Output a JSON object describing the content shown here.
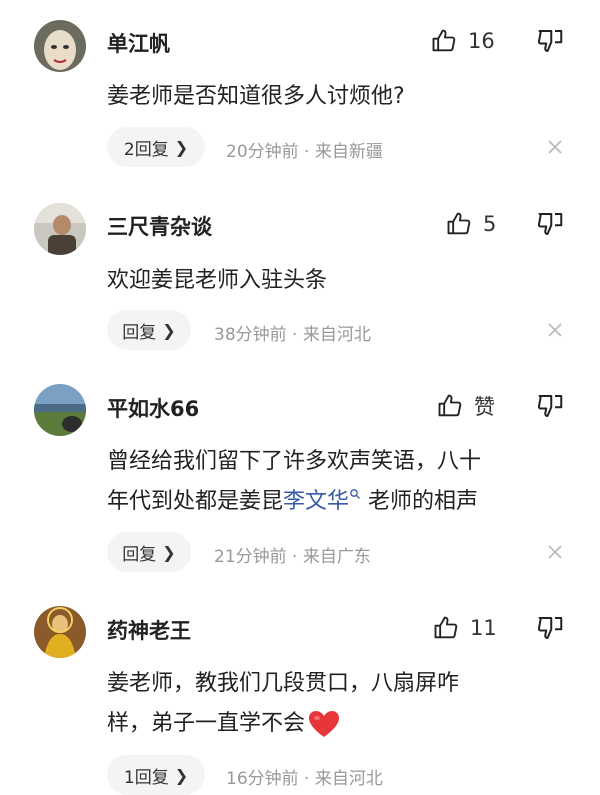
{
  "comments": [
    {
      "username": "单江帆",
      "like_count": "16",
      "body": "姜老师是否知道很多人讨烦他?",
      "reply_label": "2回复",
      "meta": "20分钟前 · 来自新疆"
    },
    {
      "username": "三尺青杂谈",
      "like_count": "5",
      "body": "欢迎姜昆老师入驻头条",
      "reply_label": "回复",
      "meta": "38分钟前 · 来自河北"
    },
    {
      "username": "平如水66",
      "like_count": "赞",
      "body_line1": "曾经给我们留下了许多欢声笑语，八十",
      "body_line2_pre": "年代到处都是姜昆",
      "body_link": "李文华",
      "body_line2_post": " 老师的相声",
      "reply_label": "回复",
      "meta": "21分钟前 · 来自广东"
    },
    {
      "username": "药神老王",
      "like_count": "11",
      "body_line1": "姜老师，教我们几段贯口，八扇屏咋",
      "body_line2": "样，弟子一直学不会",
      "reply_label": "1回复",
      "meta": "16分钟前 · 来自河北"
    }
  ],
  "icons": {
    "like": "thumbs-up-icon",
    "dislike": "thumbs-down-icon",
    "close": "close-icon",
    "chevron": "chevron-right-icon",
    "heart": "red-heart-emoji",
    "search": "search-icon"
  },
  "colors": {
    "text": "#222222",
    "meta": "#999999",
    "link": "#3a5aa8",
    "pill": "#f4f4f4",
    "heart": "#e8353a"
  }
}
